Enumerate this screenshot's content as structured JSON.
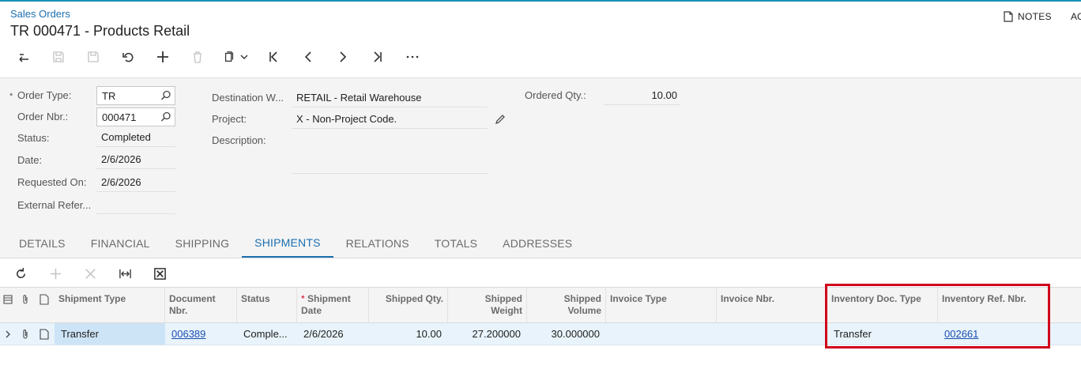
{
  "header": {
    "breadcrumb": "Sales Orders",
    "title": "TR 000471 - Products Retail",
    "notes_label": "NOTES",
    "overflow_label": "AC"
  },
  "toolbar": {
    "icons": [
      "back-icon",
      "save-close-icon",
      "save-icon",
      "undo-icon",
      "add-icon",
      "delete-icon",
      "copy-paste-icon",
      "first-record-icon",
      "previous-record-icon",
      "next-record-icon",
      "last-record-icon",
      "more-icon"
    ]
  },
  "form": {
    "order_type": {
      "label": "Order Type:",
      "value": "TR",
      "required_marker": "*"
    },
    "order_nbr": {
      "label": "Order Nbr.:",
      "value": "000471"
    },
    "status": {
      "label": "Status:",
      "value": "Completed"
    },
    "date": {
      "label": "Date:",
      "value": "2/6/2026"
    },
    "requested_on": {
      "label": "Requested On:",
      "value": "2/6/2026"
    },
    "external_ref": {
      "label": "External Refer...",
      "value": ""
    },
    "destination": {
      "label": "Destination W...",
      "value": "RETAIL - Retail Warehouse"
    },
    "project": {
      "label": "Project:",
      "value": "X - Non-Project Code."
    },
    "description": {
      "label": "Description:",
      "value": ""
    },
    "ordered_qty": {
      "label": "Ordered Qty.:",
      "value": "10.00"
    }
  },
  "tabs": [
    {
      "label": "DETAILS"
    },
    {
      "label": "FINANCIAL"
    },
    {
      "label": "SHIPPING"
    },
    {
      "label": "SHIPMENTS",
      "active": true
    },
    {
      "label": "RELATIONS"
    },
    {
      "label": "TOTALS"
    },
    {
      "label": "ADDRESSES"
    }
  ],
  "grid": {
    "columns": {
      "shipment_type": "Shipment Type",
      "document_nbr": "Document Nbr.",
      "status": "Status",
      "shipment_date": "Shipment Date",
      "shipment_date_marker": "*",
      "shipped_qty": "Shipped Qty.",
      "shipped_weight": "Shipped Weight",
      "shipped_volume": "Shipped Volume",
      "invoice_type": "Invoice Type",
      "invoice_nbr": "Invoice Nbr.",
      "inventory_doc_type": "Inventory Doc. Type",
      "inventory_ref_nbr": "Inventory Ref. Nbr."
    },
    "rows": [
      {
        "shipment_type": "Transfer",
        "document_nbr": "006389",
        "status": "Comple...",
        "shipment_date": "2/6/2026",
        "shipped_qty": "10.00",
        "shipped_weight": "27.200000",
        "shipped_volume": "30.000000",
        "invoice_type": "",
        "invoice_nbr": "",
        "inventory_doc_type": "Transfer",
        "inventory_ref_nbr": "002661"
      }
    ]
  },
  "colors": {
    "accent": "#1b6fb0",
    "highlight": "#d0021b",
    "row_selected": "#e8f3fb"
  }
}
